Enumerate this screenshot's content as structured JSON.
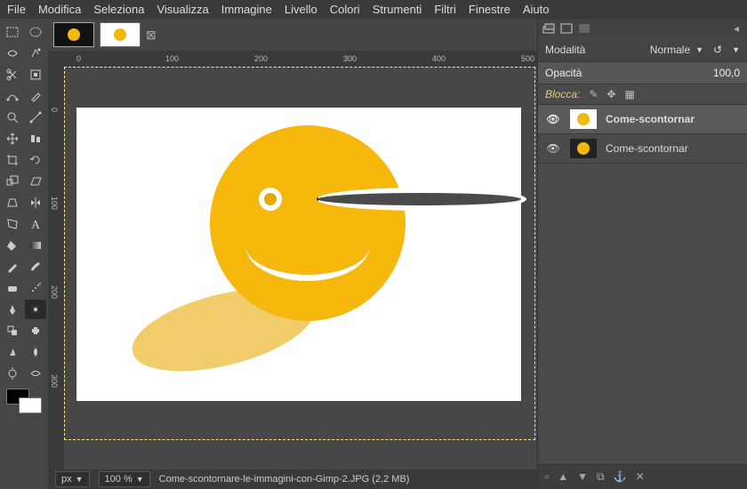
{
  "menu": [
    "File",
    "Modifica",
    "Seleziona",
    "Visualizza",
    "Immagine",
    "Livello",
    "Colori",
    "Strumenti",
    "Filtri",
    "Finestre",
    "Aiuto"
  ],
  "ruler_h": [
    "0",
    "100",
    "200",
    "300",
    "400",
    "500"
  ],
  "ruler_v": [
    "0",
    "100",
    "200",
    "300"
  ],
  "status": {
    "unit": "px",
    "zoom": "100 %",
    "filename": "Come-scontornare-le-immagini-con-Gimp-2.JPG (2,2 MB)"
  },
  "panel": {
    "mode_label": "Modalità",
    "mode_value": "Normale",
    "opacity_label": "Opacità",
    "opacity_value": "100,0",
    "lock_label": "Blocca:"
  },
  "layers": [
    {
      "name": "Come-scontornar",
      "bg": "white"
    },
    {
      "name": "Come-scontornar",
      "bg": "dark"
    }
  ]
}
